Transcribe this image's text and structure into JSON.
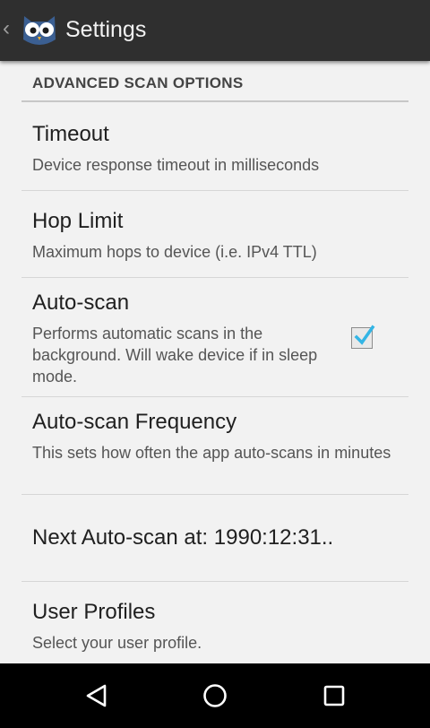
{
  "actionbar": {
    "title": "Settings",
    "up_icon": "chevron-left-icon",
    "app_icon": "owl-app-icon"
  },
  "category": {
    "title": "ADVANCED SCAN OPTIONS"
  },
  "prefs": [
    {
      "title": "Timeout",
      "summary": "Device response timeout in milliseconds"
    },
    {
      "title": "Hop Limit",
      "summary": "Maximum hops to device (i.e. IPv4 TTL)"
    },
    {
      "title": "Auto-scan",
      "summary": "Performs automatic scans in the background. Will wake device if in sleep mode.",
      "checked": true
    },
    {
      "title": "Auto-scan Frequency",
      "summary": "This sets how often the app auto-scans in minutes"
    },
    {
      "title": "Next Auto-scan at: 1990:12:31.."
    },
    {
      "title": "User Profiles",
      "summary": "Select your user profile."
    }
  ],
  "navbar": {
    "back_icon": "back-triangle-icon",
    "home_icon": "home-circle-icon",
    "recents_icon": "recents-square-icon"
  },
  "colors": {
    "actionbar_bg": "#2f2f2f",
    "content_bg": "#f2f2f2",
    "checkbox_tick": "#33b5e5",
    "navbar_bg": "#000000"
  }
}
